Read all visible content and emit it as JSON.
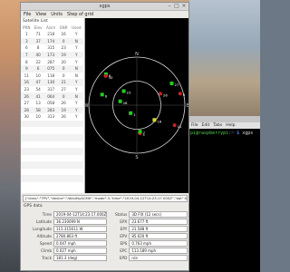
{
  "window": {
    "title": "xgps"
  },
  "menu": [
    "File",
    "View",
    "Units",
    "Step of grid"
  ],
  "sat_list": {
    "title": "Satellite List",
    "columns": [
      "PRN",
      "Elev",
      "Azim",
      "SNR",
      "Used"
    ],
    "rows": [
      [
        "1",
        "71",
        "218",
        "16",
        "Y"
      ],
      [
        "3",
        "37",
        "174",
        "0",
        "N"
      ],
      [
        "6",
        "8",
        "315",
        "23",
        "Y"
      ],
      [
        "7",
        "40",
        "173",
        "19",
        "Y"
      ],
      [
        "8",
        "22",
        "287",
        "20",
        "Y"
      ],
      [
        "9",
        "6",
        "075",
        "0",
        "N"
      ],
      [
        "11",
        "10",
        "118",
        "0",
        "N"
      ],
      [
        "16",
        "47",
        "130",
        "21",
        "Y"
      ],
      [
        "23",
        "54",
        "317",
        "27",
        "Y"
      ],
      [
        "26",
        "41",
        "064",
        "0",
        "N"
      ],
      [
        "27",
        "13",
        "058",
        "26",
        "Y"
      ],
      [
        "28",
        "58",
        "283",
        "19",
        "Y"
      ],
      [
        "30",
        "10",
        "313",
        "26",
        "Y"
      ],
      [
        "",
        "",
        "",
        "",
        ""
      ],
      [
        "",
        "",
        "",
        "",
        ""
      ],
      [
        "",
        "",
        "",
        "",
        ""
      ],
      [
        "",
        "",
        "",
        "",
        ""
      ],
      [
        "",
        "",
        "",
        "",
        ""
      ],
      [
        "",
        "",
        "",
        "",
        ""
      ],
      [
        "",
        "",
        "",
        "",
        ""
      ],
      [
        "",
        "",
        "",
        "",
        ""
      ],
      [
        "",
        "",
        "",
        "",
        ""
      ],
      [
        "",
        "",
        "",
        "",
        ""
      ]
    ]
  },
  "skyview": {
    "labels": {
      "n": "N",
      "e": "E",
      "s": "S",
      "w": "W"
    },
    "satellites": [
      {
        "prn": "1",
        "elev": 71,
        "az": 218,
        "color": "#22cc22",
        "used": true
      },
      {
        "prn": "3",
        "elev": 37,
        "az": 174,
        "color": "#cc2222",
        "used": false
      },
      {
        "prn": "6",
        "elev": 8,
        "az": 315,
        "color": "#22cc22",
        "used": true
      },
      {
        "prn": "7",
        "elev": 40,
        "az": 173,
        "color": "#22cc22",
        "used": true
      },
      {
        "prn": "8",
        "elev": 22,
        "az": 287,
        "color": "#22cc22",
        "used": true
      },
      {
        "prn": "9",
        "elev": 6,
        "az": 75,
        "color": "#cc2222",
        "used": false
      },
      {
        "prn": "11",
        "elev": 10,
        "az": 118,
        "color": "#cc2222",
        "used": false
      },
      {
        "prn": "16",
        "elev": 47,
        "az": 130,
        "color": "#dddd22",
        "used": true
      },
      {
        "prn": "23",
        "elev": 54,
        "az": 317,
        "color": "#22cc22",
        "used": true
      },
      {
        "prn": "26",
        "elev": 41,
        "az": 64,
        "color": "#cc2222",
        "used": false
      },
      {
        "prn": "27",
        "elev": 13,
        "az": 58,
        "color": "#22cc22",
        "used": true
      },
      {
        "prn": "28",
        "elev": 58,
        "az": 283,
        "color": "#22cc22",
        "used": true
      },
      {
        "prn": "30",
        "elev": 10,
        "az": 313,
        "color": "#cc2222",
        "used": false
      }
    ]
  },
  "watch_line": "{\"class\":\"TPV\",\"device\":\"/dev/ttyACM0\",\"mode\":3,\"time\":\"2019-04-12T14:23:17.000Z\",\"ept\":0.005,\"lat\":",
  "gps": {
    "title": "GPS data",
    "left": [
      {
        "label": "Time",
        "value": "2019-04-12T14:23:17.000Z"
      },
      {
        "label": "Latitude",
        "value": "36.230099 N"
      },
      {
        "label": "Longitude",
        "value": "115.315611 W"
      },
      {
        "label": "Altitude",
        "value": "2780.863 ft"
      },
      {
        "label": "Speed",
        "value": "0.047 mph"
      },
      {
        "label": "Climb",
        "value": "0.027 mph"
      },
      {
        "label": "Track",
        "value": "181.3 (deg)"
      }
    ],
    "right": [
      {
        "label": "Status",
        "value": "3D FIX (12 secs)"
      },
      {
        "label": "EPX",
        "value": "23.677 ft"
      },
      {
        "label": "EPY",
        "value": "21.588 ft"
      },
      {
        "label": "EPV",
        "value": "85.020 ft"
      },
      {
        "label": "EPS",
        "value": "0.763 mph"
      },
      {
        "label": "EPC",
        "value": "113.189 mph"
      },
      {
        "label": "EPD",
        "value": "n/a"
      }
    ]
  },
  "terminal": {
    "menu": [
      "File",
      "Edit",
      "Tabs",
      "Help"
    ],
    "user": "pi@raspberrypi",
    "path": ":~ $",
    "command": "xgps"
  }
}
